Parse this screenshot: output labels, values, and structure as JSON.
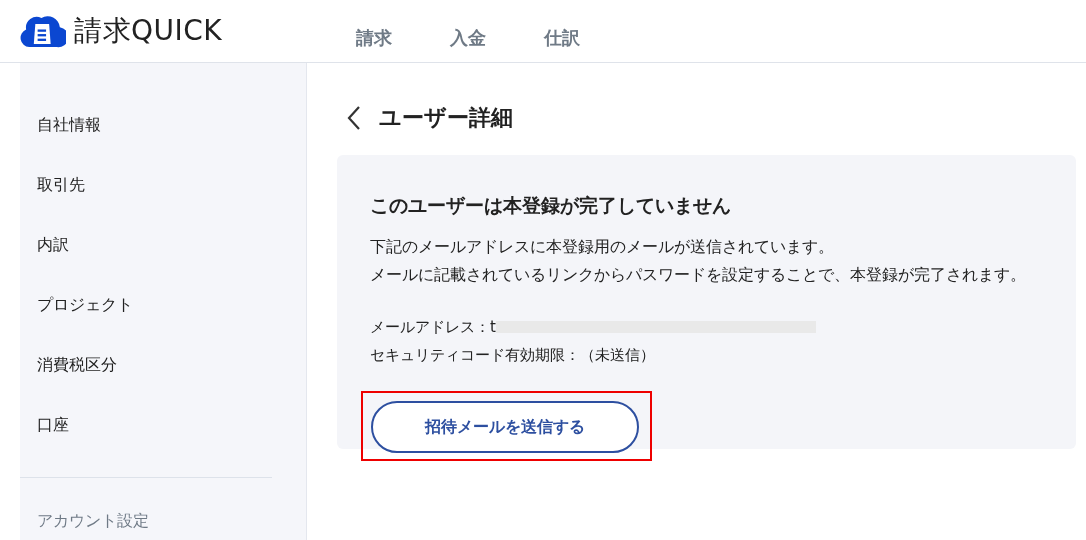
{
  "header": {
    "logo_text": "請求QUICK",
    "nav": [
      {
        "label": "請求",
        "selected": false
      },
      {
        "label": "入金",
        "selected": false
      },
      {
        "label": "仕訳",
        "selected": false
      }
    ]
  },
  "sidebar": {
    "items": [
      {
        "label": "自社情報",
        "selected": false
      },
      {
        "label": "取引先",
        "selected": false
      },
      {
        "label": "内訳",
        "selected": false
      },
      {
        "label": "プロジェクト",
        "selected": false
      },
      {
        "label": "消費税区分",
        "selected": false
      },
      {
        "label": "口座",
        "selected": false
      }
    ],
    "section_label": "アカウント設定"
  },
  "page": {
    "title": "ユーザー詳細"
  },
  "card": {
    "heading": "このユーザーは本登録が完了していません",
    "message": [
      "下記のメールアドレスに本登録用のメールが送信されています。",
      "メールに記載されているリンクからパスワードを設定することで、本登録が完了されます。"
    ],
    "fields": [
      {
        "label": "メールアドレス：",
        "value": "t",
        "redacted": true
      },
      {
        "label": "セキュリティコード有効期限：",
        "value": "（未送信）",
        "redacted": false
      }
    ],
    "button": {
      "label": "招待メールを送信する",
      "highlighted": true
    }
  }
}
